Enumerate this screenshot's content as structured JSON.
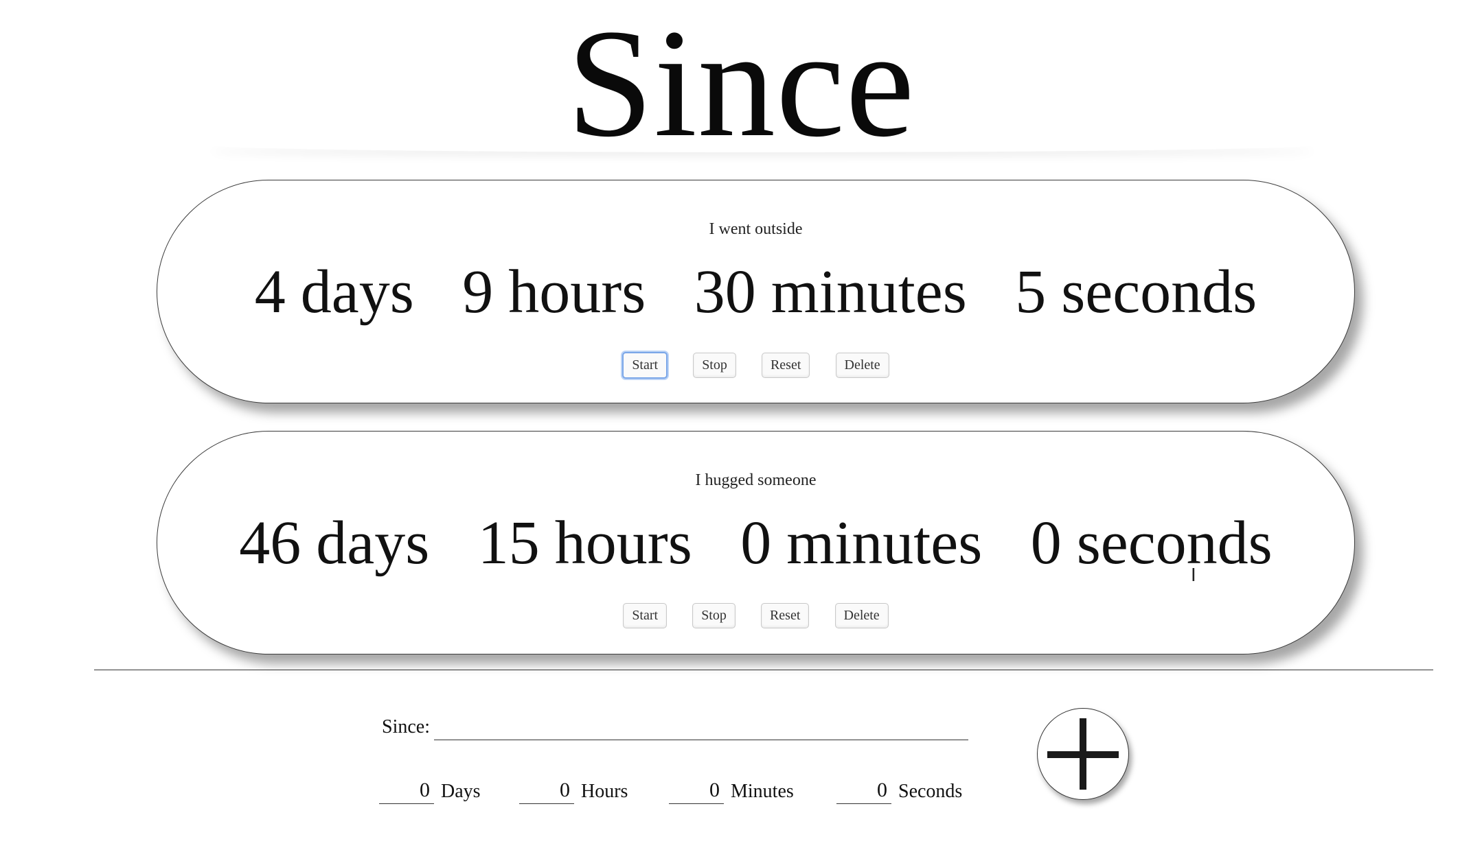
{
  "app": {
    "title": "Since"
  },
  "timers": [
    {
      "label": "I went outside",
      "days": "4",
      "days_unit": "days",
      "hours": "9",
      "hours_unit": "hours",
      "minutes": "30",
      "minutes_unit": "minutes",
      "seconds": "5",
      "seconds_unit": "seconds",
      "buttons": {
        "start": "Start",
        "stop": "Stop",
        "reset": "Reset",
        "delete": "Delete"
      }
    },
    {
      "label": "I hugged someone",
      "days": "46",
      "days_unit": "days",
      "hours": "15",
      "hours_unit": "hours",
      "minutes": "0",
      "minutes_unit": "minutes",
      "seconds": "0",
      "seconds_unit": "seconds",
      "buttons": {
        "start": "Start",
        "stop": "Stop",
        "reset": "Reset",
        "delete": "Delete"
      }
    }
  ],
  "form": {
    "since_label": "Since:",
    "since_value": "",
    "days_value": "0",
    "days_label": "Days",
    "hours_value": "0",
    "hours_label": "Hours",
    "minutes_value": "0",
    "minutes_label": "Minutes",
    "seconds_value": "0",
    "seconds_label": "Seconds",
    "add_icon": "plus-icon"
  },
  "colors": {
    "focus_ring": "#7aa6e8",
    "text": "#111111",
    "background": "#ffffff"
  }
}
